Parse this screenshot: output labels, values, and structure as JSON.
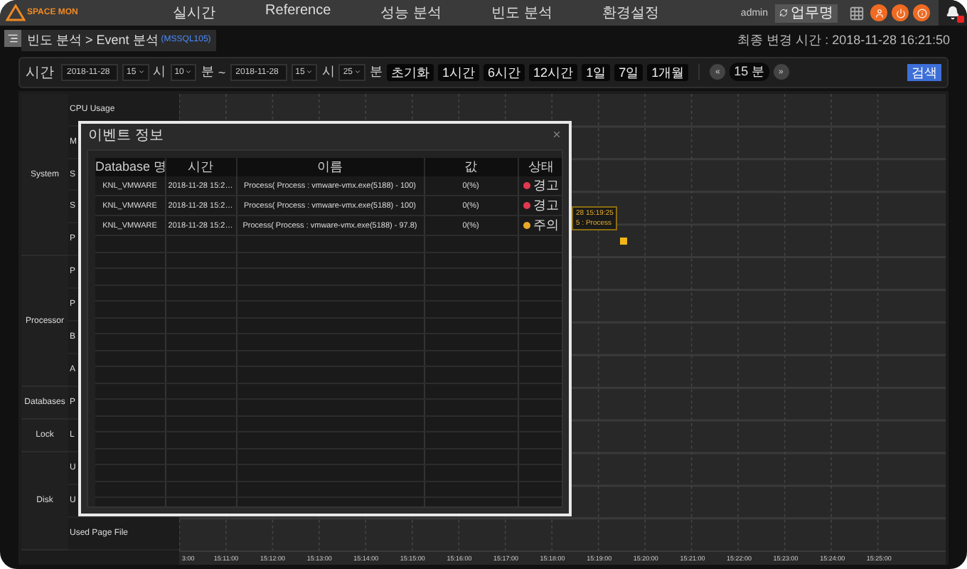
{
  "nav": {
    "logo": "SPACE MON",
    "menu": [
      "실시간",
      "Reference",
      "성능 분석",
      "빈도 분석",
      "환경설정"
    ],
    "user": "admin",
    "work_button": "업무명"
  },
  "breadcrumb": {
    "path": "빈도 분석 > Event 분석",
    "target": "(MSSQL105)"
  },
  "last_update": "최종 변경 시간 : 2018-11-28 16:21:50",
  "filter": {
    "items": [
      {
        "kind": "label",
        "text": "시간"
      },
      {
        "kind": "date",
        "text": "2018-11-28"
      },
      {
        "kind": "select",
        "text": "15"
      },
      {
        "kind": "unit",
        "text": "시"
      },
      {
        "kind": "select",
        "text": "10"
      },
      {
        "kind": "unit",
        "text": "분"
      },
      {
        "kind": "unit",
        "text": "~"
      },
      {
        "kind": "date",
        "text": "2018-11-28"
      },
      {
        "kind": "select",
        "text": "15"
      },
      {
        "kind": "unit",
        "text": "시"
      },
      {
        "kind": "select",
        "text": "25"
      },
      {
        "kind": "unit",
        "text": "분"
      },
      {
        "kind": "button",
        "text": "초기화"
      },
      {
        "kind": "button",
        "text": "1시간"
      },
      {
        "kind": "button",
        "text": "6시간"
      },
      {
        "kind": "button",
        "text": "12시간"
      },
      {
        "kind": "button",
        "text": "1일"
      },
      {
        "kind": "button",
        "text": "7일"
      },
      {
        "kind": "button",
        "text": "1개월"
      }
    ],
    "interval": {
      "prev": "«",
      "value": "15 분",
      "next": "»"
    },
    "search": "검색"
  },
  "categories": [
    {
      "label": "System",
      "metrics": [
        "CPU Usage",
        "M",
        "S",
        "S",
        "P"
      ]
    },
    {
      "label": "Processor",
      "metrics": [
        "P",
        "P",
        "B",
        "A"
      ]
    },
    {
      "label": "Databases",
      "metrics": [
        "P"
      ]
    },
    {
      "label": "Lock",
      "metrics": [
        "L"
      ]
    },
    {
      "label": "Disk",
      "metrics": [
        "U",
        "U",
        "Used Page File"
      ]
    }
  ],
  "chart": {
    "x_labels": [
      "3:00",
      "15:11:00",
      "15:12:00",
      "15:13:00",
      "15:14:00",
      "15:15:00",
      "15:16:00",
      "15:17:00",
      "15:18:00",
      "15:19:00",
      "15:20:00",
      "15:21:00",
      "15:22:00",
      "15:23:00",
      "15:24:00",
      "15:25:00"
    ],
    "tooltip": [
      "28 15:19:25",
      "5 : Process"
    ]
  },
  "modal": {
    "title": "이벤트 정보",
    "columns": [
      "Database 명",
      "시간",
      "이름",
      "값",
      "상태"
    ],
    "rows": [
      {
        "database": "KNL_VMWARE",
        "time": "2018-11-28 15:2…",
        "name": "Process( Process : vmware-vmx.exe(5188) - 100)",
        "value": "0(%)",
        "status": "경고",
        "color": "#e0394f"
      },
      {
        "database": "KNL_VMWARE",
        "time": "2018-11-28 15:2…",
        "name": "Process( Process : vmware-vmx.exe(5188) - 100)",
        "value": "0(%)",
        "status": "경고",
        "color": "#e0394f"
      },
      {
        "database": "KNL_VMWARE",
        "time": "2018-11-28 15:2…",
        "name": "Process( Process : vmware-vmx.exe(5188) - 97.8)",
        "value": "0(%)",
        "status": "주의",
        "color": "#e8a92a"
      }
    ]
  }
}
